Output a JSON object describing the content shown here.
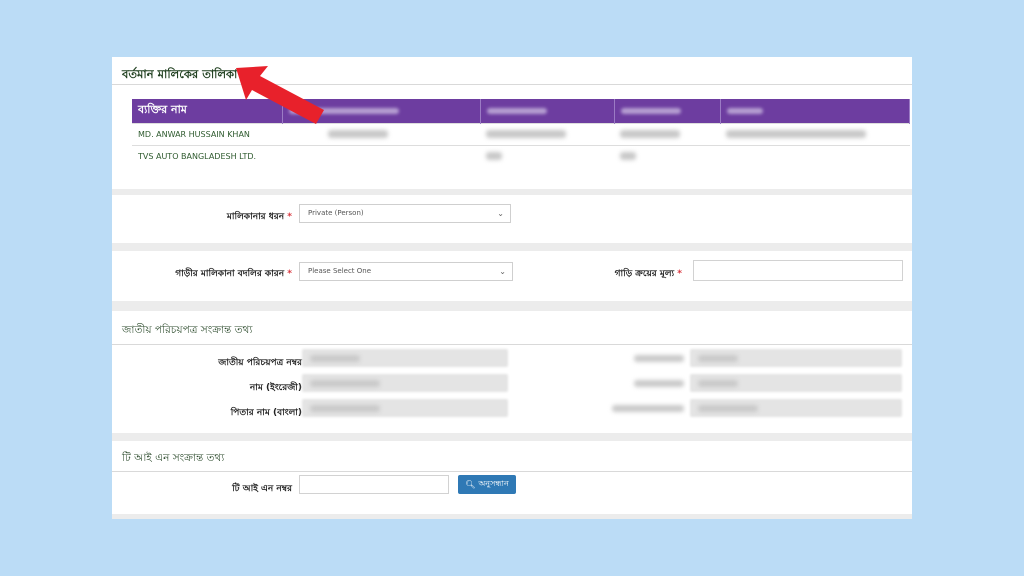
{
  "owners_section": {
    "title": "বর্তমান মালিকের তালিকা",
    "columns": [
      "ব্যক্তির নাম",
      "জাতীয় পরিচয়পত্র নম্বর",
      "পিতার নাম",
      "মাতার নাম",
      "ঠিকানা"
    ],
    "rows": [
      {
        "name": "MD. ANWAR HUSSAIN KHAN"
      },
      {
        "name": "TVS AUTO BANGLADESH LTD."
      }
    ]
  },
  "ownership_type": {
    "label": "মালিকানার ধরন",
    "value": "Private (Person)"
  },
  "transfer": {
    "reason_label": "গাড়ীর মালিকানা বদলির কারন",
    "reason_placeholder": "Please Select One",
    "price_label": "গাড়ি ক্রয়ের মূল্য"
  },
  "nid_section": {
    "title": "জাতীয় পরিচয়পত্র সংক্রান্ত তথ্য",
    "fields": [
      "জাতীয় পরিচয়পত্র নম্বর",
      "নাম (ইংরেজী)",
      "পিতার নাম (বাংলা)"
    ]
  },
  "tin_section": {
    "title": "টি আই এন সংক্রান্ত তথ্য",
    "field_label": "টি আই এন নম্বর",
    "search_button": "অনুসন্ধান"
  },
  "colors": {
    "table_header": "#6d3da0",
    "button": "#2f79b5",
    "arrow": "#e8212b",
    "background": "#bbdcf6"
  }
}
